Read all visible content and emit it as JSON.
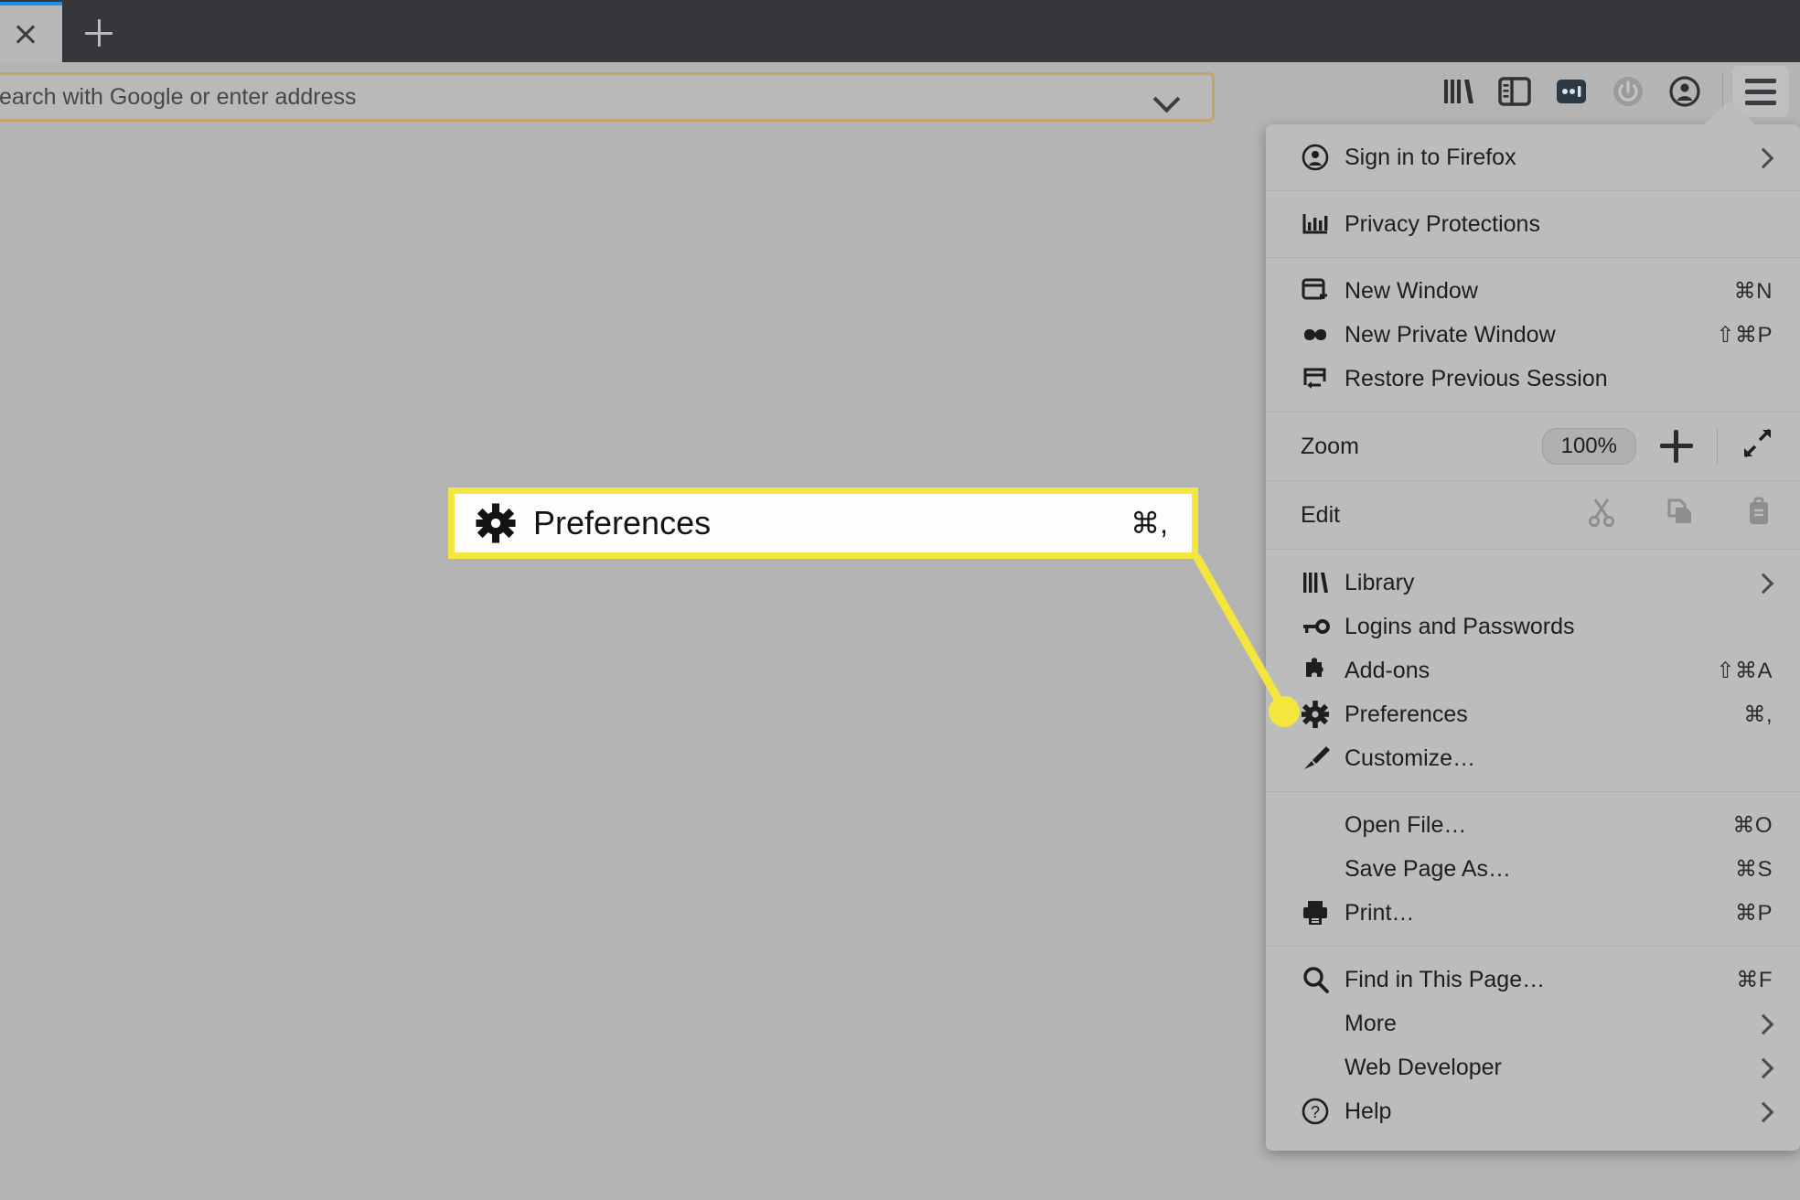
{
  "browser": {
    "tab": {
      "close_label": "×",
      "newtab_label": "+"
    },
    "urlbar": {
      "text": "earch with Google or enter address",
      "dropdown_icon": "chevron-down-icon"
    },
    "toolbar": {
      "icons": [
        {
          "name": "library-icon",
          "label": "Library"
        },
        {
          "name": "sidebar-icon",
          "label": "Sidebars"
        },
        {
          "name": "pocket-icon",
          "label": "Save to Pocket"
        },
        {
          "name": "power-icon",
          "label": "Power"
        },
        {
          "name": "account-icon",
          "label": "Account"
        }
      ],
      "menu_button": {
        "name": "hamburger-menu-icon",
        "label": "Open Application Menu"
      }
    }
  },
  "menu": {
    "groups": [
      {
        "items": [
          {
            "icon": "account-circle-icon",
            "label": "Sign in to Firefox",
            "accel": "",
            "submenu": true
          }
        ]
      },
      {
        "items": [
          {
            "icon": "privacy-chart-icon",
            "label": "Privacy Protections",
            "accel": "",
            "submenu": false
          }
        ]
      },
      {
        "items": [
          {
            "icon": "new-window-icon",
            "label": "New Window",
            "accel": "⌘N",
            "submenu": false
          },
          {
            "icon": "private-window-icon",
            "label": "New Private Window",
            "accel": "⇧⌘P",
            "submenu": false
          },
          {
            "icon": "restore-session-icon",
            "label": "Restore Previous Session",
            "accel": "",
            "submenu": false
          }
        ]
      },
      {
        "zoom_row": {
          "label": "Zoom",
          "minus_label": "−",
          "level": "100%",
          "plus_label": "+",
          "fullscreen_icon": "fullscreen-icon"
        }
      },
      {
        "edit_row": {
          "label": "Edit",
          "cut_icon": "cut-icon",
          "copy_icon": "copy-icon",
          "paste_icon": "paste-icon"
        }
      },
      {
        "items": [
          {
            "icon": "library-icon",
            "label": "Library",
            "accel": "",
            "submenu": true
          },
          {
            "icon": "key-icon",
            "label": "Logins and Passwords",
            "accel": "",
            "submenu": false
          },
          {
            "icon": "addons-puzzle-icon",
            "label": "Add-ons",
            "accel": "⇧⌘A",
            "submenu": false
          },
          {
            "icon": "gear-icon",
            "label": "Preferences",
            "accel": "⌘,",
            "submenu": false,
            "highlighted": true
          },
          {
            "icon": "brush-icon",
            "label": "Customize…",
            "accel": "",
            "submenu": false
          }
        ]
      },
      {
        "items": [
          {
            "icon": "",
            "label": "Open File…",
            "accel": "⌘O",
            "submenu": false
          },
          {
            "icon": "",
            "label": "Save Page As…",
            "accel": "⌘S",
            "submenu": false
          },
          {
            "icon": "printer-icon",
            "label": "Print…",
            "accel": "⌘P",
            "submenu": false
          }
        ]
      },
      {
        "items": [
          {
            "icon": "search-icon",
            "label": "Find in This Page…",
            "accel": "⌘F",
            "submenu": false
          },
          {
            "icon": "",
            "label": "More",
            "accel": "",
            "submenu": true
          },
          {
            "icon": "",
            "label": "Web Developer",
            "accel": "",
            "submenu": true
          },
          {
            "icon": "help-circle-icon",
            "label": "Help",
            "accel": "",
            "submenu": true
          }
        ]
      }
    ]
  },
  "callout": {
    "icon": "gear-icon",
    "label": "Preferences",
    "accel": "⌘,",
    "border_color": "#f5e63d",
    "marker_color": "#f5e63d"
  }
}
